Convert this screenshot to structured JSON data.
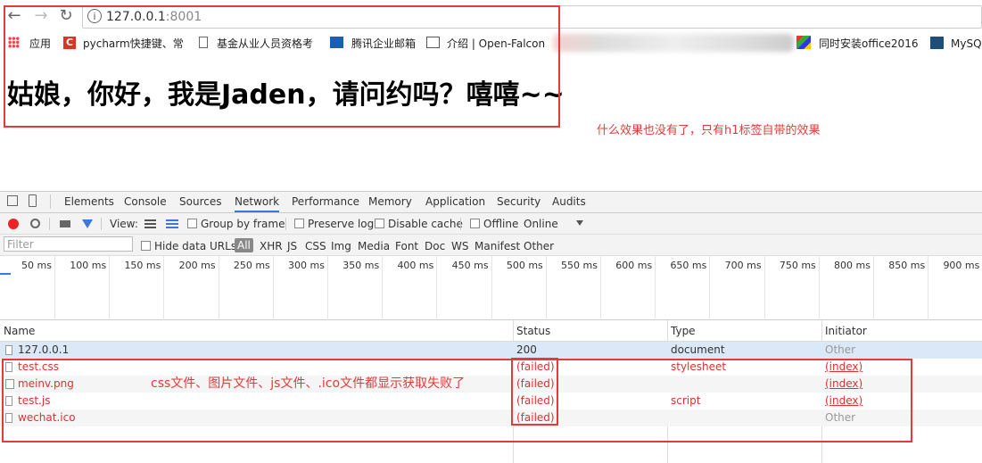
{
  "browser": {
    "url_host": "127.0.0.1",
    "url_port": ":8001",
    "info_icon": "i"
  },
  "bookmarks": [
    {
      "label": "应用",
      "icon": "apps-grid-icon"
    },
    {
      "label": "pycharm快捷键、常",
      "icon": "red-c-icon"
    },
    {
      "label": "基金从业人员资格考",
      "icon": "page-icon"
    },
    {
      "label": "腾讯企业邮箱",
      "icon": "tencent-mail-icon"
    },
    {
      "label": "介绍 | Open-Falcon",
      "icon": "book-icon"
    },
    {
      "label": "同时安装office2016",
      "icon": "windows-icon"
    },
    {
      "label": "MySQ",
      "icon": "mysql-icon"
    }
  ],
  "page": {
    "heading": "姑娘，你好，我是Jaden，请问约吗？嘻嘻~~",
    "annotation_top": "什么效果也没有了，只有h1标签自带的效果",
    "annotation_rows": "css文件、图片文件、js文件、.ico文件都显示获取失败了"
  },
  "devtools": {
    "tabs": [
      "Elements",
      "Console",
      "Sources",
      "Network",
      "Performance",
      "Memory",
      "Application",
      "Security",
      "Audits"
    ],
    "active_tab": "Network",
    "toolbar": {
      "view_label": "View:",
      "group_by_frame": "Group by frame",
      "preserve_log": "Preserve log",
      "disable_cache": "Disable cache",
      "offline": "Offline",
      "online": "Online"
    },
    "filter": {
      "placeholder": "Filter",
      "hide_data_urls": "Hide data URLs",
      "types": [
        "All",
        "XHR",
        "JS",
        "CSS",
        "Img",
        "Media",
        "Font",
        "Doc",
        "WS",
        "Manifest",
        "Other"
      ]
    },
    "timeline_ticks": [
      "50 ms",
      "100 ms",
      "150 ms",
      "200 ms",
      "250 ms",
      "300 ms",
      "350 ms",
      "400 ms",
      "450 ms",
      "500 ms",
      "550 ms",
      "600 ms",
      "650 ms",
      "700 ms",
      "750 ms",
      "800 ms",
      "850 ms",
      "900 ms"
    ],
    "columns": {
      "name": "Name",
      "status": "Status",
      "type": "Type",
      "initiator": "Initiator"
    },
    "rows": [
      {
        "name": "127.0.0.1",
        "status": "200",
        "type": "document",
        "initiator": "Other",
        "failed": false
      },
      {
        "name": "test.css",
        "status": "(failed)",
        "type": "stylesheet",
        "initiator": "(index)",
        "failed": true
      },
      {
        "name": "meinv.png",
        "status": "(failed)",
        "type": "",
        "initiator": "(index)",
        "failed": true
      },
      {
        "name": "test.js",
        "status": "(failed)",
        "type": "script",
        "initiator": "(index)",
        "failed": true
      },
      {
        "name": "wechat.ico",
        "status": "(failed)",
        "type": "",
        "initiator": "Other",
        "failed": true
      }
    ]
  },
  "colors": {
    "annotation_red": "#e53a3a",
    "failed_red": "#e03030",
    "selected_row": "#dbe8f8"
  }
}
